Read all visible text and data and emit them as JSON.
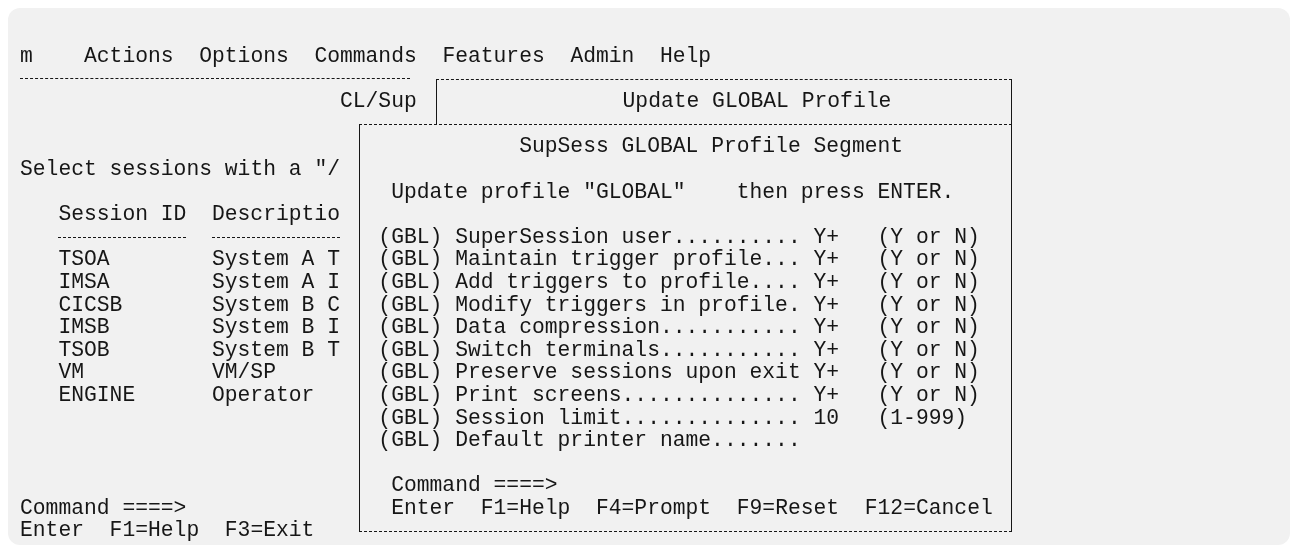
{
  "menu_bar": [
    "m",
    "Actions",
    "Options",
    "Commands",
    "Features",
    "Admin",
    "Help"
  ],
  "session_panel": {
    "title": "CL/Sup",
    "instruction": "Select sessions with a \"/",
    "columns": [
      "Session ID",
      "Descriptio"
    ],
    "rows": [
      {
        "session_id": "TSOA",
        "description": "System A T"
      },
      {
        "session_id": "IMSA",
        "description": "System A I"
      },
      {
        "session_id": "CICSB",
        "description": "System B C"
      },
      {
        "session_id": "IMSB",
        "description": "System B I"
      },
      {
        "session_id": "TSOB",
        "description": "System B T"
      },
      {
        "session_id": "VM",
        "description": "VM/SP"
      },
      {
        "session_id": "ENGINE",
        "description": "Operator"
      }
    ],
    "command_label": "Command ====>",
    "function_keys": [
      "Enter",
      "F1=Help",
      "F3=Exit"
    ]
  },
  "dialog": {
    "title": "Update GLOBAL Profile",
    "segment_title": "SupSess GLOBAL Profile Segment",
    "instruction": "Update profile \"GLOBAL\"    then press ENTER.",
    "fields": [
      {
        "scope": "(GBL)",
        "label": "SuperSession user..........",
        "value": "Y+",
        "hint": "(Y or N)"
      },
      {
        "scope": "(GBL)",
        "label": "Maintain trigger profile...",
        "value": "Y+",
        "hint": "(Y or N)"
      },
      {
        "scope": "(GBL)",
        "label": "Add triggers to profile....",
        "value": "Y+",
        "hint": "(Y or N)"
      },
      {
        "scope": "(GBL)",
        "label": "Modify triggers in profile.",
        "value": "Y+",
        "hint": "(Y or N)"
      },
      {
        "scope": "(GBL)",
        "label": "Data compression...........",
        "value": "Y+",
        "hint": "(Y or N)"
      },
      {
        "scope": "(GBL)",
        "label": "Switch terminals...........",
        "value": "Y+",
        "hint": "(Y or N)"
      },
      {
        "scope": "(GBL)",
        "label": "Preserve sessions upon exit",
        "value": "Y+",
        "hint": "(Y or N)"
      },
      {
        "scope": "(GBL)",
        "label": "Print screens..............",
        "value": "Y+",
        "hint": "(Y or N)"
      },
      {
        "scope": "(GBL)",
        "label": "Session limit..............",
        "value": "10",
        "hint": "(1-999)"
      },
      {
        "scope": "(GBL)",
        "label": "Default printer name......."
      }
    ],
    "command_label": "Command ====>",
    "function_keys": [
      "Enter",
      "F1=Help",
      "F4=Prompt",
      "F9=Reset",
      "F12=Cancel"
    ]
  }
}
